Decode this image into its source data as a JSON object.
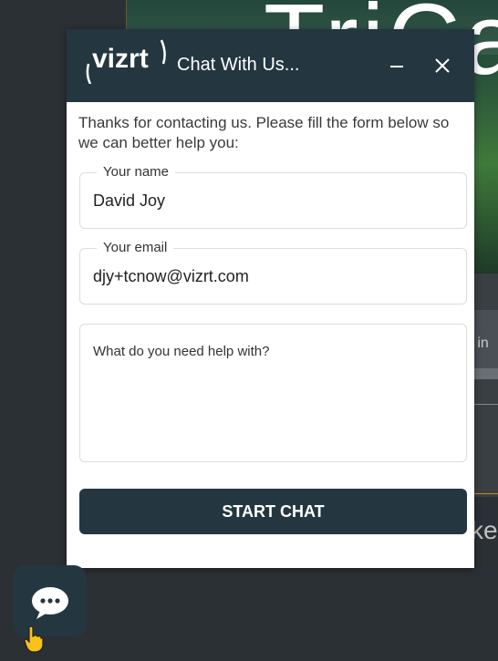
{
  "background": {
    "hero_title": "TriCast",
    "search_fragment": "o in",
    "text_fragment": "ke"
  },
  "chat": {
    "title": "Chat With Us...",
    "logo_text": "vizrt",
    "logo_icon": "vizrt-logo-icon",
    "minimize_icon": "minimize-icon",
    "close_icon": "close-icon",
    "intro": "Thanks for contacting us. Please fill the form below so we can better help you:",
    "fields": {
      "name_label": "Your name",
      "name_value": "David Joy",
      "email_label": "Your email",
      "email_value": "djy+tcnow@vizrt.com",
      "help_placeholder": "What do you need help with?"
    },
    "start_button": "START CHAT"
  },
  "launcher": {
    "icon": "chat-bubble-icon",
    "cursor_icon": "hand-pointer-icon"
  },
  "colors": {
    "header_bg": "#243740",
    "page_bg": "#2b3035",
    "button_bg": "#243740"
  }
}
